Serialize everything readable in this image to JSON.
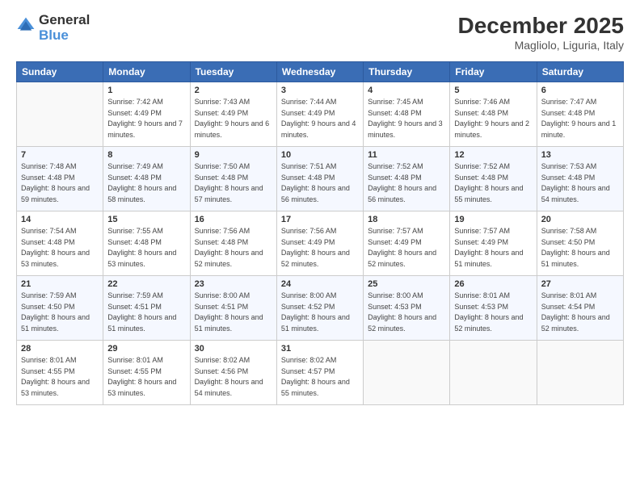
{
  "header": {
    "logo_general": "General",
    "logo_blue": "Blue",
    "month_year": "December 2025",
    "location": "Magliolo, Liguria, Italy"
  },
  "days_of_week": [
    "Sunday",
    "Monday",
    "Tuesday",
    "Wednesday",
    "Thursday",
    "Friday",
    "Saturday"
  ],
  "weeks": [
    [
      {
        "day": "",
        "sunrise": "",
        "sunset": "",
        "daylight": ""
      },
      {
        "day": "1",
        "sunrise": "Sunrise: 7:42 AM",
        "sunset": "Sunset: 4:49 PM",
        "daylight": "Daylight: 9 hours and 7 minutes."
      },
      {
        "day": "2",
        "sunrise": "Sunrise: 7:43 AM",
        "sunset": "Sunset: 4:49 PM",
        "daylight": "Daylight: 9 hours and 6 minutes."
      },
      {
        "day": "3",
        "sunrise": "Sunrise: 7:44 AM",
        "sunset": "Sunset: 4:49 PM",
        "daylight": "Daylight: 9 hours and 4 minutes."
      },
      {
        "day": "4",
        "sunrise": "Sunrise: 7:45 AM",
        "sunset": "Sunset: 4:48 PM",
        "daylight": "Daylight: 9 hours and 3 minutes."
      },
      {
        "day": "5",
        "sunrise": "Sunrise: 7:46 AM",
        "sunset": "Sunset: 4:48 PM",
        "daylight": "Daylight: 9 hours and 2 minutes."
      },
      {
        "day": "6",
        "sunrise": "Sunrise: 7:47 AM",
        "sunset": "Sunset: 4:48 PM",
        "daylight": "Daylight: 9 hours and 1 minute."
      }
    ],
    [
      {
        "day": "7",
        "sunrise": "Sunrise: 7:48 AM",
        "sunset": "Sunset: 4:48 PM",
        "daylight": "Daylight: 8 hours and 59 minutes."
      },
      {
        "day": "8",
        "sunrise": "Sunrise: 7:49 AM",
        "sunset": "Sunset: 4:48 PM",
        "daylight": "Daylight: 8 hours and 58 minutes."
      },
      {
        "day": "9",
        "sunrise": "Sunrise: 7:50 AM",
        "sunset": "Sunset: 4:48 PM",
        "daylight": "Daylight: 8 hours and 57 minutes."
      },
      {
        "day": "10",
        "sunrise": "Sunrise: 7:51 AM",
        "sunset": "Sunset: 4:48 PM",
        "daylight": "Daylight: 8 hours and 56 minutes."
      },
      {
        "day": "11",
        "sunrise": "Sunrise: 7:52 AM",
        "sunset": "Sunset: 4:48 PM",
        "daylight": "Daylight: 8 hours and 56 minutes."
      },
      {
        "day": "12",
        "sunrise": "Sunrise: 7:52 AM",
        "sunset": "Sunset: 4:48 PM",
        "daylight": "Daylight: 8 hours and 55 minutes."
      },
      {
        "day": "13",
        "sunrise": "Sunrise: 7:53 AM",
        "sunset": "Sunset: 4:48 PM",
        "daylight": "Daylight: 8 hours and 54 minutes."
      }
    ],
    [
      {
        "day": "14",
        "sunrise": "Sunrise: 7:54 AM",
        "sunset": "Sunset: 4:48 PM",
        "daylight": "Daylight: 8 hours and 53 minutes."
      },
      {
        "day": "15",
        "sunrise": "Sunrise: 7:55 AM",
        "sunset": "Sunset: 4:48 PM",
        "daylight": "Daylight: 8 hours and 53 minutes."
      },
      {
        "day": "16",
        "sunrise": "Sunrise: 7:56 AM",
        "sunset": "Sunset: 4:48 PM",
        "daylight": "Daylight: 8 hours and 52 minutes."
      },
      {
        "day": "17",
        "sunrise": "Sunrise: 7:56 AM",
        "sunset": "Sunset: 4:49 PM",
        "daylight": "Daylight: 8 hours and 52 minutes."
      },
      {
        "day": "18",
        "sunrise": "Sunrise: 7:57 AM",
        "sunset": "Sunset: 4:49 PM",
        "daylight": "Daylight: 8 hours and 52 minutes."
      },
      {
        "day": "19",
        "sunrise": "Sunrise: 7:57 AM",
        "sunset": "Sunset: 4:49 PM",
        "daylight": "Daylight: 8 hours and 51 minutes."
      },
      {
        "day": "20",
        "sunrise": "Sunrise: 7:58 AM",
        "sunset": "Sunset: 4:50 PM",
        "daylight": "Daylight: 8 hours and 51 minutes."
      }
    ],
    [
      {
        "day": "21",
        "sunrise": "Sunrise: 7:59 AM",
        "sunset": "Sunset: 4:50 PM",
        "daylight": "Daylight: 8 hours and 51 minutes."
      },
      {
        "day": "22",
        "sunrise": "Sunrise: 7:59 AM",
        "sunset": "Sunset: 4:51 PM",
        "daylight": "Daylight: 8 hours and 51 minutes."
      },
      {
        "day": "23",
        "sunrise": "Sunrise: 8:00 AM",
        "sunset": "Sunset: 4:51 PM",
        "daylight": "Daylight: 8 hours and 51 minutes."
      },
      {
        "day": "24",
        "sunrise": "Sunrise: 8:00 AM",
        "sunset": "Sunset: 4:52 PM",
        "daylight": "Daylight: 8 hours and 51 minutes."
      },
      {
        "day": "25",
        "sunrise": "Sunrise: 8:00 AM",
        "sunset": "Sunset: 4:53 PM",
        "daylight": "Daylight: 8 hours and 52 minutes."
      },
      {
        "day": "26",
        "sunrise": "Sunrise: 8:01 AM",
        "sunset": "Sunset: 4:53 PM",
        "daylight": "Daylight: 8 hours and 52 minutes."
      },
      {
        "day": "27",
        "sunrise": "Sunrise: 8:01 AM",
        "sunset": "Sunset: 4:54 PM",
        "daylight": "Daylight: 8 hours and 52 minutes."
      }
    ],
    [
      {
        "day": "28",
        "sunrise": "Sunrise: 8:01 AM",
        "sunset": "Sunset: 4:55 PM",
        "daylight": "Daylight: 8 hours and 53 minutes."
      },
      {
        "day": "29",
        "sunrise": "Sunrise: 8:01 AM",
        "sunset": "Sunset: 4:55 PM",
        "daylight": "Daylight: 8 hours and 53 minutes."
      },
      {
        "day": "30",
        "sunrise": "Sunrise: 8:02 AM",
        "sunset": "Sunset: 4:56 PM",
        "daylight": "Daylight: 8 hours and 54 minutes."
      },
      {
        "day": "31",
        "sunrise": "Sunrise: 8:02 AM",
        "sunset": "Sunset: 4:57 PM",
        "daylight": "Daylight: 8 hours and 55 minutes."
      },
      {
        "day": "",
        "sunrise": "",
        "sunset": "",
        "daylight": ""
      },
      {
        "day": "",
        "sunrise": "",
        "sunset": "",
        "daylight": ""
      },
      {
        "day": "",
        "sunrise": "",
        "sunset": "",
        "daylight": ""
      }
    ]
  ]
}
